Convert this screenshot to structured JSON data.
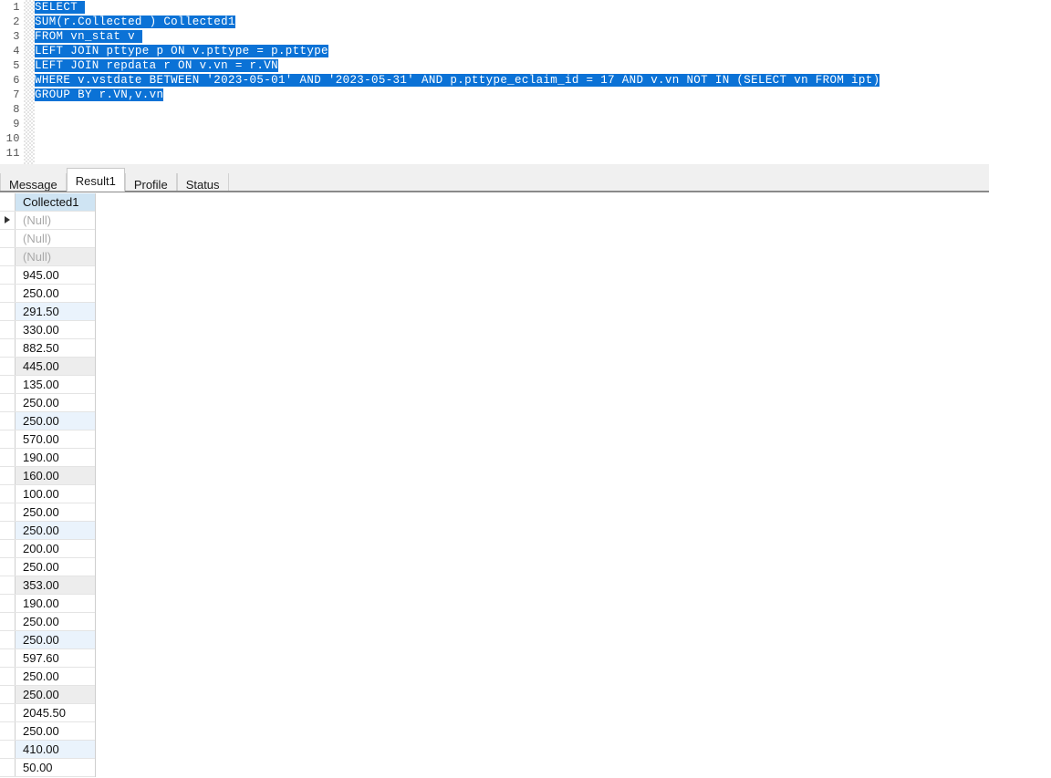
{
  "editor": {
    "line_numbers": [
      "1",
      "2",
      "3",
      "4",
      "5",
      "6",
      "7",
      "8",
      "9",
      "10",
      "11"
    ],
    "lines": [
      "SELECT ",
      "SUM(r.Collected ) Collected1",
      "FROM vn_stat v ",
      "LEFT JOIN pttype p ON v.pttype = p.pttype",
      "LEFT JOIN repdata r ON v.vn = r.VN",
      "WHERE v.vstdate BETWEEN '2023-05-01' AND '2023-05-31' AND p.pttype_eclaim_id = 17 AND v.vn NOT IN (SELECT vn FROM ipt)",
      "GROUP BY r.VN,v.vn",
      "",
      "",
      "",
      ""
    ],
    "selection_color": "#0b72d6",
    "selection_text_color": "#ffffff"
  },
  "tabs": [
    {
      "label": "Message",
      "active": false
    },
    {
      "label": "Result1",
      "active": true
    },
    {
      "label": "Profile",
      "active": false
    },
    {
      "label": "Status",
      "active": false
    }
  ],
  "grid": {
    "column_header": "Collected1",
    "header_color": "#cfe4f3",
    "current_row_index": 0,
    "rows": [
      {
        "value": "(Null)",
        "null": true,
        "stripe": "white"
      },
      {
        "value": "(Null)",
        "null": true,
        "stripe": "white"
      },
      {
        "value": "(Null)",
        "null": true,
        "stripe": "gray"
      },
      {
        "value": "945.00",
        "null": false,
        "stripe": "white"
      },
      {
        "value": "250.00",
        "null": false,
        "stripe": "white"
      },
      {
        "value": "291.50",
        "null": false,
        "stripe": "blue"
      },
      {
        "value": "330.00",
        "null": false,
        "stripe": "white"
      },
      {
        "value": "882.50",
        "null": false,
        "stripe": "white"
      },
      {
        "value": "445.00",
        "null": false,
        "stripe": "gray"
      },
      {
        "value": "135.00",
        "null": false,
        "stripe": "white"
      },
      {
        "value": "250.00",
        "null": false,
        "stripe": "white"
      },
      {
        "value": "250.00",
        "null": false,
        "stripe": "blue"
      },
      {
        "value": "570.00",
        "null": false,
        "stripe": "white"
      },
      {
        "value": "190.00",
        "null": false,
        "stripe": "white"
      },
      {
        "value": "160.00",
        "null": false,
        "stripe": "gray"
      },
      {
        "value": "100.00",
        "null": false,
        "stripe": "white"
      },
      {
        "value": "250.00",
        "null": false,
        "stripe": "white"
      },
      {
        "value": "250.00",
        "null": false,
        "stripe": "blue"
      },
      {
        "value": "200.00",
        "null": false,
        "stripe": "white"
      },
      {
        "value": "250.00",
        "null": false,
        "stripe": "white"
      },
      {
        "value": "353.00",
        "null": false,
        "stripe": "gray"
      },
      {
        "value": "190.00",
        "null": false,
        "stripe": "white"
      },
      {
        "value": "250.00",
        "null": false,
        "stripe": "white"
      },
      {
        "value": "250.00",
        "null": false,
        "stripe": "blue"
      },
      {
        "value": "597.60",
        "null": false,
        "stripe": "white"
      },
      {
        "value": "250.00",
        "null": false,
        "stripe": "white"
      },
      {
        "value": "250.00",
        "null": false,
        "stripe": "gray"
      },
      {
        "value": "2045.50",
        "null": false,
        "stripe": "white"
      },
      {
        "value": "250.00",
        "null": false,
        "stripe": "white"
      },
      {
        "value": "410.00",
        "null": false,
        "stripe": "blue"
      },
      {
        "value": "50.00",
        "null": false,
        "stripe": "white"
      }
    ]
  }
}
